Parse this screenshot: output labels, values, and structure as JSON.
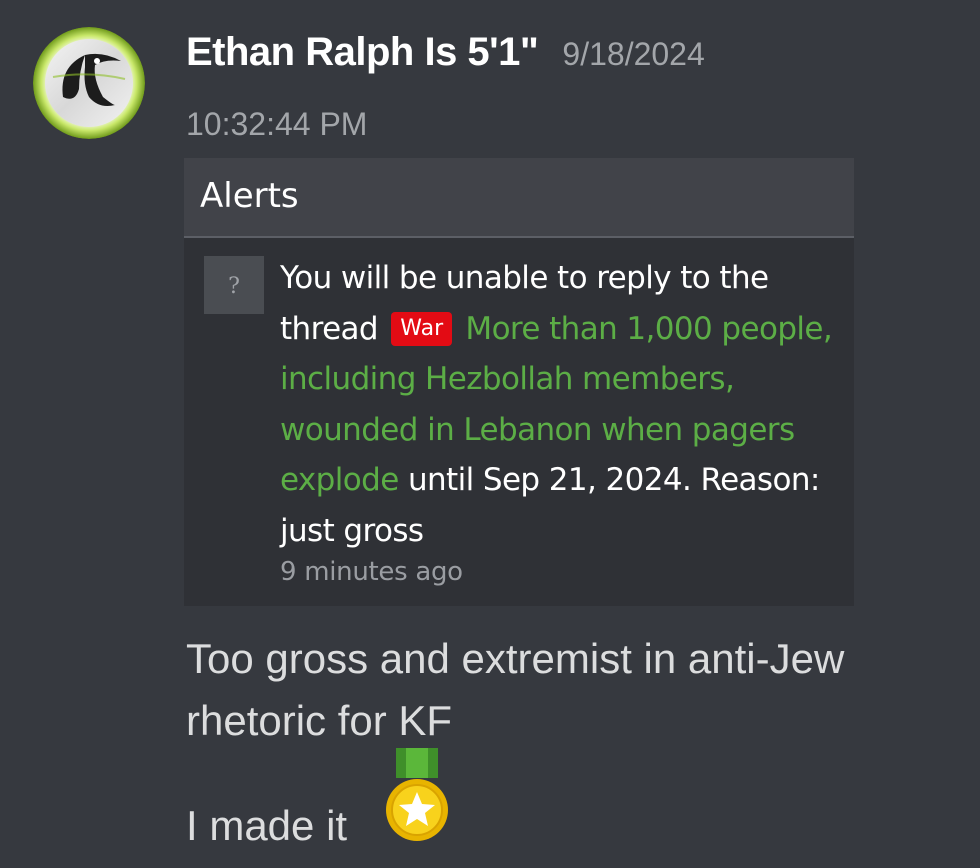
{
  "message": {
    "username": "Ethan Ralph Is 5'1\"",
    "date": "9/18/2024",
    "time": "10:32:44 PM",
    "body_line_1": "Too gross and extremist in anti-Jew rhetoric for KF",
    "body_line_2": "I made it",
    "emoji": "medal-icon"
  },
  "embed": {
    "title": "Alerts",
    "alert_icon_glyph": "?",
    "alert_prefix": "You will be unable to reply to the thread",
    "badge_label": "War",
    "thread_title": "More than 1,000 people, including Hezbollah members, wounded in Lebanon when pagers explode",
    "alert_suffix": "until Sep 21, 2024. Reason: just gross",
    "time_ago": "9 minutes ago"
  },
  "colors": {
    "background": "#36393f",
    "embed_bg": "#2f3136",
    "embed_header_bg": "#414349",
    "link_green": "#5cae46",
    "badge_red": "#e30b14",
    "muted_text": "#a3a6aa"
  }
}
